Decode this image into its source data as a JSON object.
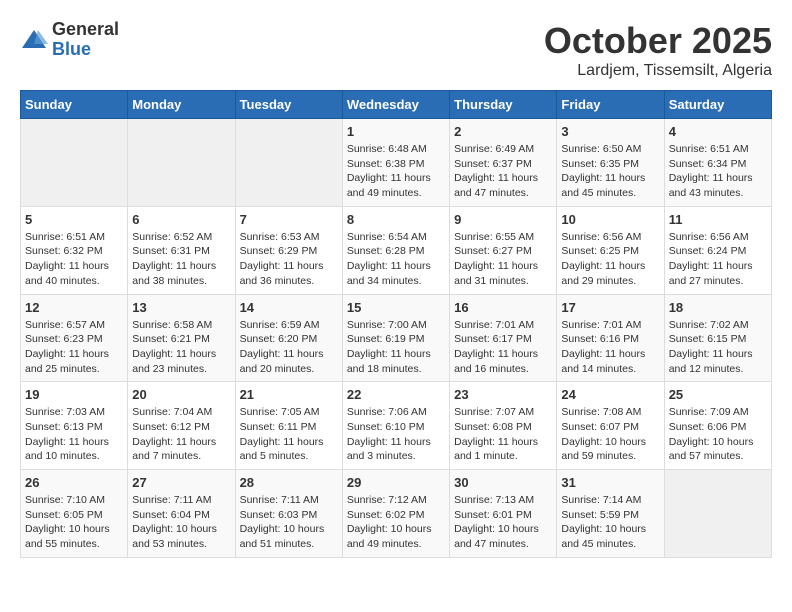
{
  "logo": {
    "general": "General",
    "blue": "Blue"
  },
  "title": "October 2025",
  "location": "Lardjem, Tissemsilt, Algeria",
  "days_of_week": [
    "Sunday",
    "Monday",
    "Tuesday",
    "Wednesday",
    "Thursday",
    "Friday",
    "Saturday"
  ],
  "weeks": [
    [
      {
        "day": "",
        "info": ""
      },
      {
        "day": "",
        "info": ""
      },
      {
        "day": "",
        "info": ""
      },
      {
        "day": "1",
        "info": "Sunrise: 6:48 AM\nSunset: 6:38 PM\nDaylight: 11 hours and 49 minutes."
      },
      {
        "day": "2",
        "info": "Sunrise: 6:49 AM\nSunset: 6:37 PM\nDaylight: 11 hours and 47 minutes."
      },
      {
        "day": "3",
        "info": "Sunrise: 6:50 AM\nSunset: 6:35 PM\nDaylight: 11 hours and 45 minutes."
      },
      {
        "day": "4",
        "info": "Sunrise: 6:51 AM\nSunset: 6:34 PM\nDaylight: 11 hours and 43 minutes."
      }
    ],
    [
      {
        "day": "5",
        "info": "Sunrise: 6:51 AM\nSunset: 6:32 PM\nDaylight: 11 hours and 40 minutes."
      },
      {
        "day": "6",
        "info": "Sunrise: 6:52 AM\nSunset: 6:31 PM\nDaylight: 11 hours and 38 minutes."
      },
      {
        "day": "7",
        "info": "Sunrise: 6:53 AM\nSunset: 6:29 PM\nDaylight: 11 hours and 36 minutes."
      },
      {
        "day": "8",
        "info": "Sunrise: 6:54 AM\nSunset: 6:28 PM\nDaylight: 11 hours and 34 minutes."
      },
      {
        "day": "9",
        "info": "Sunrise: 6:55 AM\nSunset: 6:27 PM\nDaylight: 11 hours and 31 minutes."
      },
      {
        "day": "10",
        "info": "Sunrise: 6:56 AM\nSunset: 6:25 PM\nDaylight: 11 hours and 29 minutes."
      },
      {
        "day": "11",
        "info": "Sunrise: 6:56 AM\nSunset: 6:24 PM\nDaylight: 11 hours and 27 minutes."
      }
    ],
    [
      {
        "day": "12",
        "info": "Sunrise: 6:57 AM\nSunset: 6:23 PM\nDaylight: 11 hours and 25 minutes."
      },
      {
        "day": "13",
        "info": "Sunrise: 6:58 AM\nSunset: 6:21 PM\nDaylight: 11 hours and 23 minutes."
      },
      {
        "day": "14",
        "info": "Sunrise: 6:59 AM\nSunset: 6:20 PM\nDaylight: 11 hours and 20 minutes."
      },
      {
        "day": "15",
        "info": "Sunrise: 7:00 AM\nSunset: 6:19 PM\nDaylight: 11 hours and 18 minutes."
      },
      {
        "day": "16",
        "info": "Sunrise: 7:01 AM\nSunset: 6:17 PM\nDaylight: 11 hours and 16 minutes."
      },
      {
        "day": "17",
        "info": "Sunrise: 7:01 AM\nSunset: 6:16 PM\nDaylight: 11 hours and 14 minutes."
      },
      {
        "day": "18",
        "info": "Sunrise: 7:02 AM\nSunset: 6:15 PM\nDaylight: 11 hours and 12 minutes."
      }
    ],
    [
      {
        "day": "19",
        "info": "Sunrise: 7:03 AM\nSunset: 6:13 PM\nDaylight: 11 hours and 10 minutes."
      },
      {
        "day": "20",
        "info": "Sunrise: 7:04 AM\nSunset: 6:12 PM\nDaylight: 11 hours and 7 minutes."
      },
      {
        "day": "21",
        "info": "Sunrise: 7:05 AM\nSunset: 6:11 PM\nDaylight: 11 hours and 5 minutes."
      },
      {
        "day": "22",
        "info": "Sunrise: 7:06 AM\nSunset: 6:10 PM\nDaylight: 11 hours and 3 minutes."
      },
      {
        "day": "23",
        "info": "Sunrise: 7:07 AM\nSunset: 6:08 PM\nDaylight: 11 hours and 1 minute."
      },
      {
        "day": "24",
        "info": "Sunrise: 7:08 AM\nSunset: 6:07 PM\nDaylight: 10 hours and 59 minutes."
      },
      {
        "day": "25",
        "info": "Sunrise: 7:09 AM\nSunset: 6:06 PM\nDaylight: 10 hours and 57 minutes."
      }
    ],
    [
      {
        "day": "26",
        "info": "Sunrise: 7:10 AM\nSunset: 6:05 PM\nDaylight: 10 hours and 55 minutes."
      },
      {
        "day": "27",
        "info": "Sunrise: 7:11 AM\nSunset: 6:04 PM\nDaylight: 10 hours and 53 minutes."
      },
      {
        "day": "28",
        "info": "Sunrise: 7:11 AM\nSunset: 6:03 PM\nDaylight: 10 hours and 51 minutes."
      },
      {
        "day": "29",
        "info": "Sunrise: 7:12 AM\nSunset: 6:02 PM\nDaylight: 10 hours and 49 minutes."
      },
      {
        "day": "30",
        "info": "Sunrise: 7:13 AM\nSunset: 6:01 PM\nDaylight: 10 hours and 47 minutes."
      },
      {
        "day": "31",
        "info": "Sunrise: 7:14 AM\nSunset: 5:59 PM\nDaylight: 10 hours and 45 minutes."
      },
      {
        "day": "",
        "info": ""
      }
    ]
  ]
}
